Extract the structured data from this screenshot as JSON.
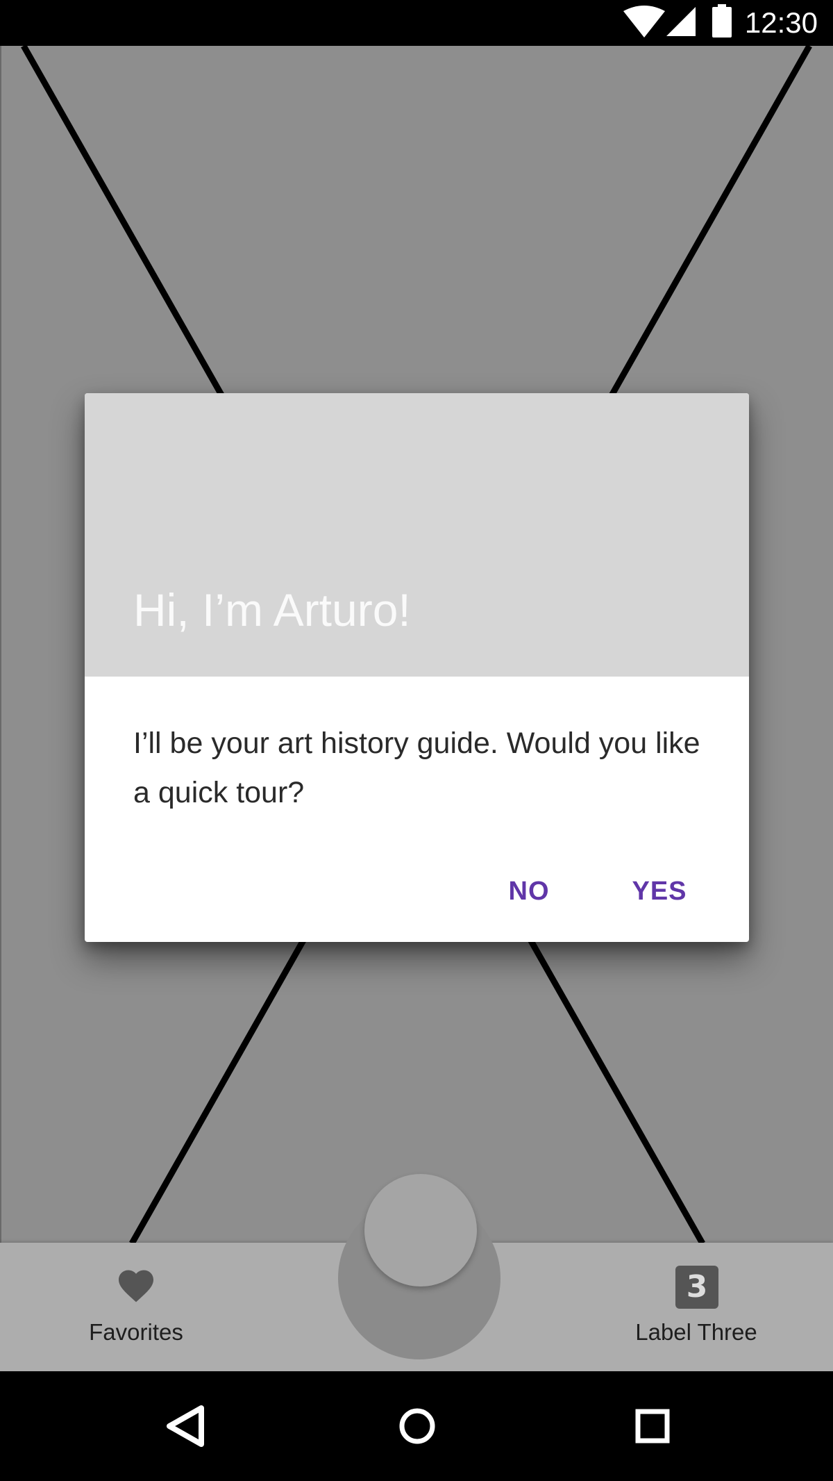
{
  "status_bar": {
    "time": "12:30",
    "icons": [
      "wifi-icon",
      "cell-signal-icon",
      "battery-icon"
    ]
  },
  "dialog": {
    "title": "Hi, I’m Arturo!",
    "body": "I’ll be your art history guide. Would you like a quick tour?",
    "negative_button": "NO",
    "positive_button": "YES",
    "button_color": "#6036a8"
  },
  "bottom_nav": {
    "items": [
      {
        "label": "Favorites",
        "icon": "heart-icon"
      },
      {
        "label": "Label Three",
        "icon": "filter-3-icon",
        "badge_text": "3"
      }
    ]
  },
  "system_nav": {
    "icons": [
      "back-icon",
      "home-icon",
      "recents-icon"
    ]
  }
}
